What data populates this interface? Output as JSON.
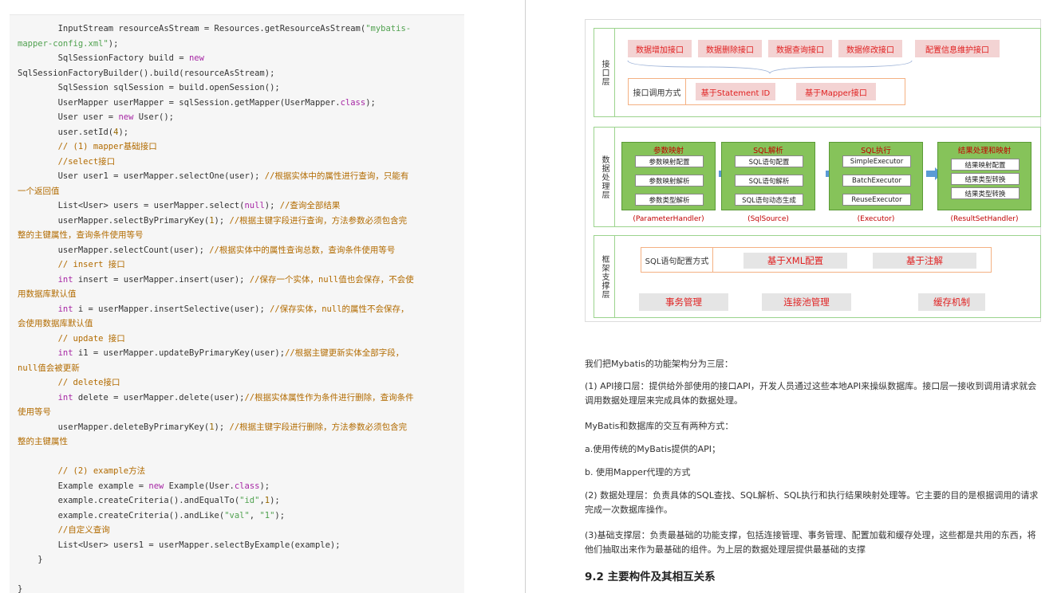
{
  "code": {
    "lines": [
      {
        "parts": [
          {
            "t": "        InputStream resourceAsStream = Resources.getResourceAsStream("
          },
          {
            "t": "\"mybatis-",
            "c": "str"
          }
        ]
      },
      {
        "parts": [
          {
            "t": "mapper-config.xml\"",
            "c": "str"
          },
          {
            "t": ");"
          }
        ]
      },
      {
        "parts": [
          {
            "t": "        SqlSessionFactory build = "
          },
          {
            "t": "new",
            "c": "kw"
          }
        ]
      },
      {
        "parts": [
          {
            "t": "SqlSessionFactoryBuilder().build(resourceAsStream);"
          }
        ]
      },
      {
        "parts": [
          {
            "t": "        SqlSession sqlSession = build.openSession();"
          }
        ]
      },
      {
        "parts": [
          {
            "t": "        UserMapper userMapper = sqlSession.getMapper(UserMapper."
          },
          {
            "t": "class",
            "c": "kw"
          },
          {
            "t": ");"
          }
        ]
      },
      {
        "parts": [
          {
            "t": "        User user = "
          },
          {
            "t": "new",
            "c": "kw"
          },
          {
            "t": " User();"
          }
        ]
      },
      {
        "parts": [
          {
            "t": "        user.setId("
          },
          {
            "t": "4",
            "c": "num"
          },
          {
            "t": ");"
          }
        ]
      },
      {
        "parts": [
          {
            "t": "        // (1) mapper基础接口",
            "c": "cm"
          }
        ]
      },
      {
        "parts": [
          {
            "t": "        //select接口",
            "c": "cm"
          }
        ]
      },
      {
        "parts": [
          {
            "t": "        User user1 = userMapper.selectOne(user); "
          },
          {
            "t": "//根据实体中的属性进行查询，只能有",
            "c": "cm"
          }
        ]
      },
      {
        "parts": [
          {
            "t": "一个返回值",
            "c": "cm"
          }
        ]
      },
      {
        "parts": [
          {
            "t": "        List<User> users = userMapper.select("
          },
          {
            "t": "null",
            "c": "kw"
          },
          {
            "t": "); "
          },
          {
            "t": "//查询全部结果",
            "c": "cm"
          }
        ]
      },
      {
        "parts": [
          {
            "t": "        userMapper.selectByPrimaryKey("
          },
          {
            "t": "1",
            "c": "num"
          },
          {
            "t": "); "
          },
          {
            "t": "//根据主键字段进行查询，方法参数必须包含完",
            "c": "cm"
          }
        ]
      },
      {
        "parts": [
          {
            "t": "整的主键属性，查询条件使用等号",
            "c": "cm"
          }
        ]
      },
      {
        "parts": [
          {
            "t": "        userMapper.selectCount(user); "
          },
          {
            "t": "//根据实体中的属性查询总数，查询条件使用等号",
            "c": "cm"
          }
        ]
      },
      {
        "parts": [
          {
            "t": "        // insert 接口",
            "c": "cm"
          }
        ]
      },
      {
        "parts": [
          {
            "t": "        "
          },
          {
            "t": "int",
            "c": "kw"
          },
          {
            "t": " insert = userMapper.insert(user); "
          },
          {
            "t": "//保存一个实体，null值也会保存，不会使",
            "c": "cm"
          }
        ]
      },
      {
        "parts": [
          {
            "t": "用数据库默认值",
            "c": "cm"
          }
        ]
      },
      {
        "parts": [
          {
            "t": "        "
          },
          {
            "t": "int",
            "c": "kw"
          },
          {
            "t": " i = userMapper.insertSelective(user); "
          },
          {
            "t": "//保存实体，null的属性不会保存，",
            "c": "cm"
          }
        ]
      },
      {
        "parts": [
          {
            "t": "会使用数据库默认值",
            "c": "cm"
          }
        ]
      },
      {
        "parts": [
          {
            "t": "        // update 接口",
            "c": "cm"
          }
        ]
      },
      {
        "parts": [
          {
            "t": "        "
          },
          {
            "t": "int",
            "c": "kw"
          },
          {
            "t": " i1 = userMapper.updateByPrimaryKey(user);"
          },
          {
            "t": "//根据主键更新实体全部字段，",
            "c": "cm"
          }
        ]
      },
      {
        "parts": [
          {
            "t": "null值会被更新",
            "c": "cm"
          }
        ]
      },
      {
        "parts": [
          {
            "t": "        // delete接口",
            "c": "cm"
          }
        ]
      },
      {
        "parts": [
          {
            "t": "        "
          },
          {
            "t": "int",
            "c": "kw"
          },
          {
            "t": " delete = userMapper.delete(user);"
          },
          {
            "t": "//根据实体属性作为条件进行删除，查询条件",
            "c": "cm"
          }
        ]
      },
      {
        "parts": [
          {
            "t": "使用等号",
            "c": "cm"
          }
        ]
      },
      {
        "parts": [
          {
            "t": "        userMapper.deleteByPrimaryKey("
          },
          {
            "t": "1",
            "c": "num"
          },
          {
            "t": "); "
          },
          {
            "t": "//根据主键字段进行删除，方法参数必须包含完",
            "c": "cm"
          }
        ]
      },
      {
        "parts": [
          {
            "t": "整的主键属性",
            "c": "cm"
          }
        ]
      },
      {
        "parts": [
          {
            "t": ""
          }
        ]
      },
      {
        "parts": [
          {
            "t": "        // (2) example方法",
            "c": "cm"
          }
        ]
      },
      {
        "parts": [
          {
            "t": "        Example example = "
          },
          {
            "t": "new",
            "c": "kw"
          },
          {
            "t": " Example(User."
          },
          {
            "t": "class",
            "c": "kw"
          },
          {
            "t": ");"
          }
        ]
      },
      {
        "parts": [
          {
            "t": "        example.createCriteria().andEqualTo("
          },
          {
            "t": "\"id\"",
            "c": "str"
          },
          {
            "t": ","
          },
          {
            "t": "1",
            "c": "num"
          },
          {
            "t": ");"
          }
        ]
      },
      {
        "parts": [
          {
            "t": "        example.createCriteria().andLike("
          },
          {
            "t": "\"val\"",
            "c": "str"
          },
          {
            "t": ", "
          },
          {
            "t": "\"1\"",
            "c": "str"
          },
          {
            "t": ");"
          }
        ]
      },
      {
        "parts": [
          {
            "t": "        //自定义查询",
            "c": "cm"
          }
        ]
      },
      {
        "parts": [
          {
            "t": "        List<User> users1 = userMapper.selectByExample(example);"
          }
        ]
      },
      {
        "parts": [
          {
            "t": "    }"
          }
        ]
      },
      {
        "parts": [
          {
            "t": ""
          }
        ]
      },
      {
        "parts": [
          {
            "t": "}"
          }
        ]
      }
    ]
  },
  "diagram": {
    "interface_layer": {
      "label": "接口层",
      "apis": [
        "数据增加接口",
        "数据删除接口",
        "数据查询接口",
        "数据修改接口",
        "配置信息维护接口"
      ],
      "call_label": "接口调用方式",
      "call_methods": [
        "基于Statement ID",
        "基于Mapper接口"
      ]
    },
    "processing_layer": {
      "label": "数据处理层",
      "stages": [
        {
          "title": "参数映射",
          "items": [
            "参数映射配置",
            "参数映射解析",
            "参数类型解析"
          ],
          "caption": "(ParameterHandler)"
        },
        {
          "title": "SQL解析",
          "items": [
            "SQL语句配置",
            "SQL语句解析",
            "SQL语句动态生成"
          ],
          "caption": "(SqlSource)"
        },
        {
          "title": "SQL执行",
          "items": [
            "SimpleExecutor",
            "BatchExecutor",
            "ReuseExecutor"
          ],
          "caption": "(Executor)"
        },
        {
          "title": "结果处理和映射",
          "items": [
            "结果映射配置",
            "结果类型转换",
            "结果类型转换"
          ],
          "caption": "(ResultSetHandler)"
        }
      ]
    },
    "support_layer": {
      "label": "框架支撑层",
      "config_label": "SQL语句配置方式",
      "config_methods": [
        "基于XML配置",
        "基于注解"
      ],
      "services": [
        "事务管理",
        "连接池管理",
        "缓存机制"
      ]
    }
  },
  "text": {
    "p1": "我们把Mybatis的功能架构分为三层：",
    "p2": "(1) API接口层：提供给外部使用的接口API，开发人员通过这些本地API来操纵数据库。接口层一接收到调用请求就会调用数据处理层来完成具体的数据处理。",
    "p3": "MyBatis和数据库的交互有两种方式：",
    "p4": "a.使用传统的MyBatis提供的API；",
    "p5": "b. 使用Mapper代理的方式",
    "p6": "(2) 数据处理层：负责具体的SQL查找、SQL解析、SQL执行和执行结果映射处理等。它主要的目的是根据调用的请求完成一次数据库操作。",
    "p7": "(3)基础支撑层：负责最基础的功能支撑，包括连接管理、事务管理、配置加载和缓存处理，这些都是共用的东西，将他们抽取出来作为最基础的组件。为上层的数据处理层提供最基础的支撑",
    "heading": "9.2 主要构件及其相互关系"
  }
}
